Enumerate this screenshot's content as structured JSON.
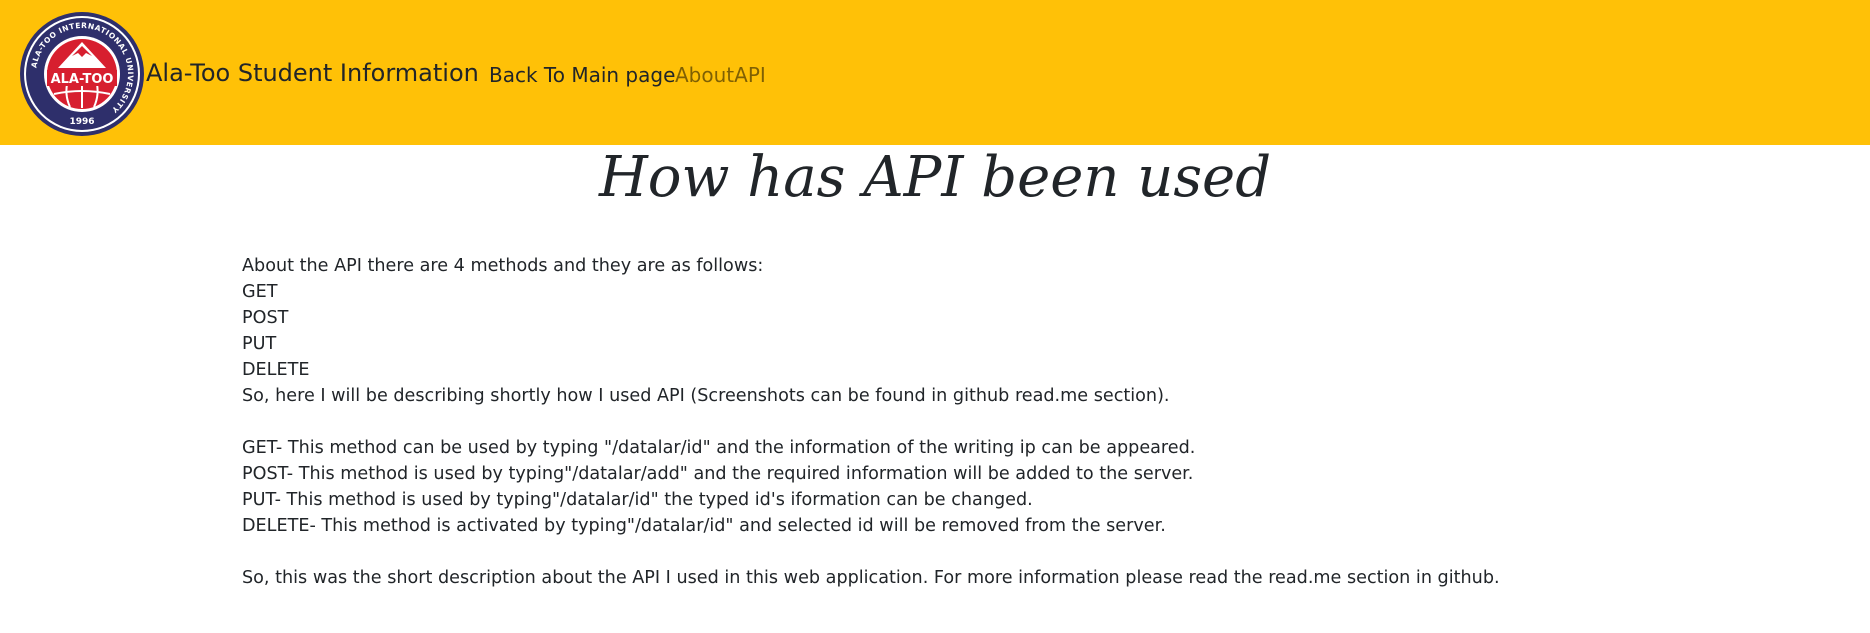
{
  "nav": {
    "logo": {
      "ring_text": "ALA-TOO INTERNATIONAL UNIVERSITY",
      "center_text": "ALA-TOO",
      "year": "1996"
    },
    "brand": "Ala-Too Student Information",
    "links": [
      "Back To Main page",
      "AboutAPI"
    ]
  },
  "page": {
    "title": "How has API been used",
    "intro": "About the API there are 4 methods and they are as follows:",
    "methods": [
      "GET",
      "POST",
      "PUT",
      "DELETE"
    ],
    "describing": "So, here I will be describing shortly how I used API (Screenshots can be found in github read.me section).",
    "details": [
      "GET- This method can be used by typing \"/datalar/id\" and the information of the writing ip can be appeared.",
      "POST- This method is used by typing\"/datalar/add\" and the required information will be added to the server.",
      "PUT- This method is used by typing\"/datalar/id\" the typed id's iformation can be changed.",
      "DELETE- This method is activated by typing\"/datalar/id\" and selected id will be removed from the server."
    ],
    "closing": "So, this was the short description about the API I used in this web application. For more information please read the read.me section in github."
  },
  "colors": {
    "navbar_bg": "#ffc107",
    "logo_navy": "#2e2f6b",
    "logo_red": "#d71f2f"
  }
}
